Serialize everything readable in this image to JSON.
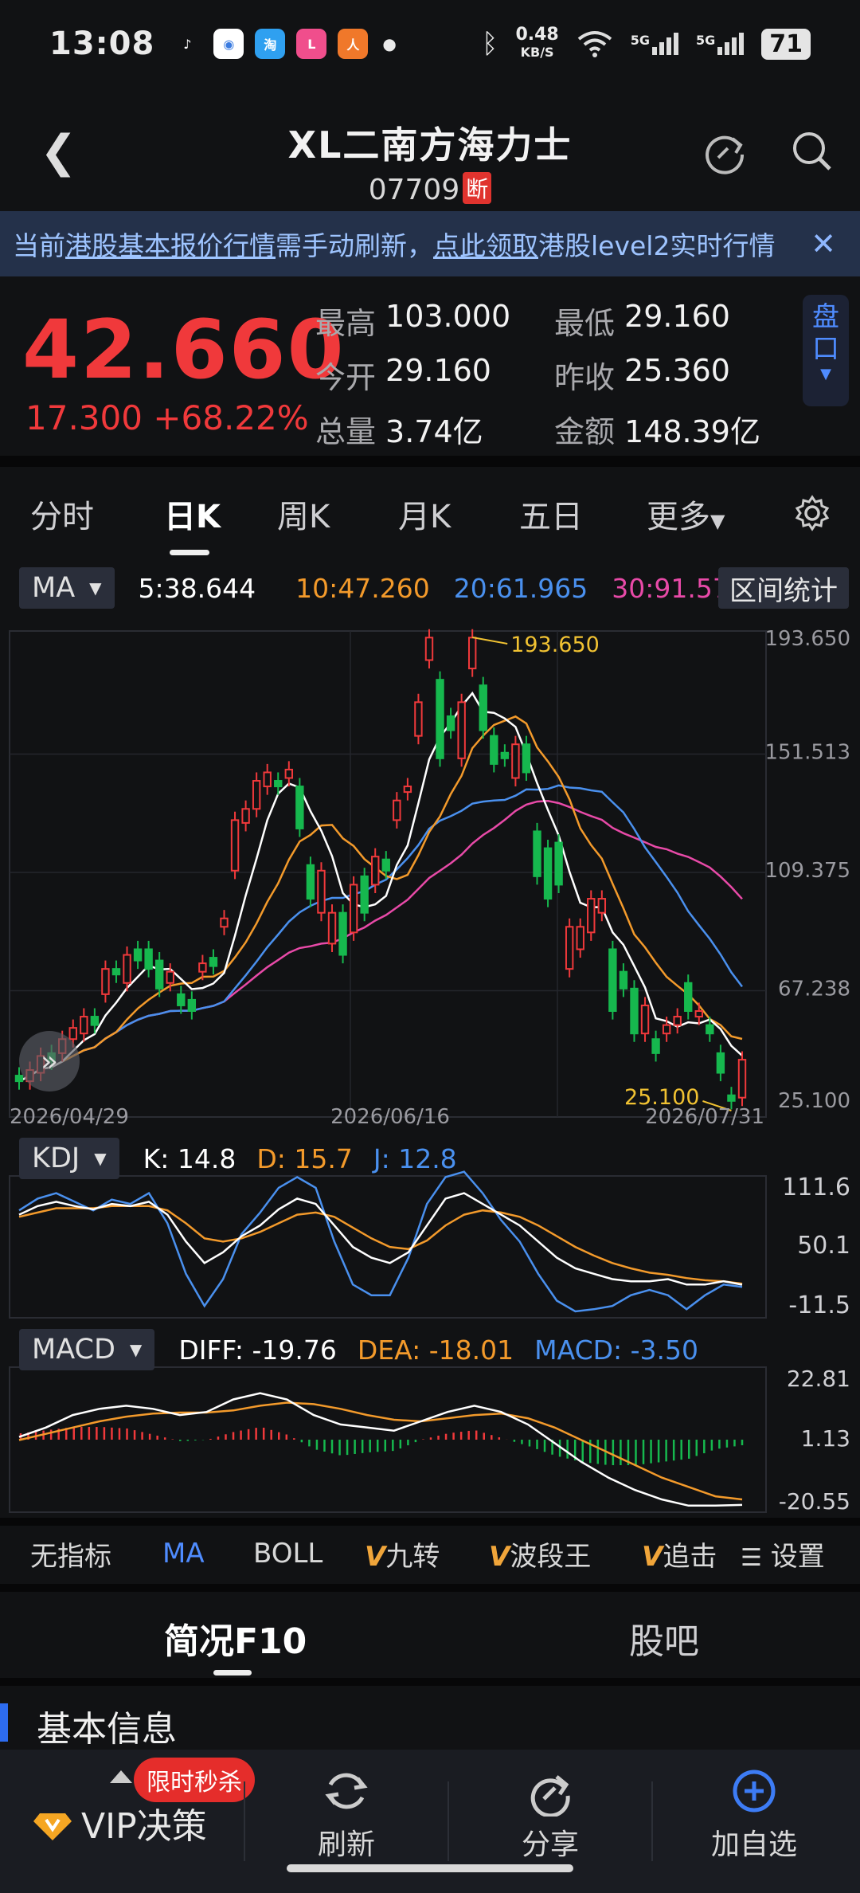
{
  "status_bar": {
    "time": "13:08",
    "net_speed": "0.48",
    "net_unit": "KB/S",
    "signal_1": "5G",
    "signal_2": "5G",
    "battery": "71",
    "apps": [
      {
        "name": "tiktok-icon",
        "color": "#111214",
        "glyph": "♪"
      },
      {
        "name": "app-icon-1",
        "color": "#ffffff",
        "glyph": "◉"
      },
      {
        "name": "app-icon-2",
        "color": "#2fa0f0",
        "glyph": "淘"
      },
      {
        "name": "app-icon-3",
        "color": "#f04e8c",
        "glyph": "L"
      },
      {
        "name": "app-icon-4",
        "color": "#f0782a",
        "glyph": "人"
      }
    ]
  },
  "header": {
    "title": "XL二南方海力士",
    "code": "07709",
    "halt_badge": "断"
  },
  "banner": {
    "text_1": "当前",
    "link_1": "港股基本报价行情",
    "text_2": "需手动刷新，",
    "link_2": "点此领取",
    "text_3": "港股level2实时行情",
    "close": "✕"
  },
  "quote": {
    "price": "42.660",
    "change_abs": "17.300",
    "change_pct": "+68.22%",
    "stats": [
      [
        {
          "label": "最高",
          "value": "103.000"
        },
        {
          "label": "最低",
          "value": "29.160"
        }
      ],
      [
        {
          "label": "今开",
          "value": "29.160"
        },
        {
          "label": "昨收",
          "value": "25.360"
        }
      ],
      [
        {
          "label": "总量",
          "value": "3.74亿"
        },
        {
          "label": "金额",
          "value": "148.39亿"
        }
      ]
    ],
    "pankou": [
      "盘",
      "口"
    ]
  },
  "tabs": {
    "items": [
      "分时",
      "日K",
      "周K",
      "月K",
      "五日",
      "更多"
    ],
    "active": "日K"
  },
  "ma_bar": {
    "button": "MA",
    "ma5": "5:38.644",
    "ma10": "10:47.260",
    "ma20": "20:61.965",
    "ma30": "30:91.578",
    "range_stats": "区间统计"
  },
  "kdj_bar": {
    "button": "KDJ",
    "k": "K: 14.8",
    "d": "D: 15.7",
    "j": "J: 12.8"
  },
  "macd_bar": {
    "button": "MACD",
    "diff": "DIFF: -19.76",
    "dea": "DEA: -18.01",
    "macd": "MACD: -3.50"
  },
  "indicator_bar": {
    "items": [
      "无指标",
      "MA",
      "BOLL",
      "九转",
      "波段王",
      "追击",
      "设置"
    ],
    "active": "MA",
    "v_prefix": "V"
  },
  "section_tabs": {
    "items": [
      "简况F10",
      "股吧"
    ],
    "active": "简况F10"
  },
  "basic_info": {
    "title": "基本信息"
  },
  "bottom_nav": {
    "vip_label": "VIP决策",
    "promo": "限时秒杀",
    "items": [
      "刷新",
      "分享",
      "加自选"
    ]
  },
  "colors": {
    "up": "#f0393b",
    "down": "#16b84e",
    "ma5": "#ffffff",
    "ma10": "#f39a2b",
    "ma20": "#4a90ee",
    "ma30": "#e84aa8",
    "accent": "#4f8cff"
  },
  "chart_data": [
    {
      "type": "candlestick",
      "title": "",
      "x_tick_labels": [
        "2026/04/29",
        "2026/06/16",
        "2026/07/31"
      ],
      "y_tick_labels": [
        "193.650",
        "151.513",
        "109.375",
        "67.238",
        "25.100"
      ],
      "ylim": [
        25.1,
        193.65
      ],
      "annotations": [
        {
          "text": "193.650",
          "kind": "max"
        },
        {
          "text": "25.100",
          "kind": "min"
        }
      ],
      "candles": [
        {
          "o": 37,
          "c": 35
        },
        {
          "o": 35,
          "c": 39
        },
        {
          "o": 38,
          "c": 44
        },
        {
          "o": 45,
          "c": 42
        },
        {
          "o": 45,
          "c": 50
        },
        {
          "o": 50,
          "c": 54
        },
        {
          "o": 52,
          "c": 58
        },
        {
          "o": 58,
          "c": 55
        },
        {
          "o": 66,
          "c": 75
        },
        {
          "o": 75,
          "c": 73
        },
        {
          "o": 70,
          "c": 80
        },
        {
          "o": 82,
          "c": 78
        },
        {
          "o": 82,
          "c": 75
        },
        {
          "o": 78,
          "c": 68
        },
        {
          "o": 70,
          "c": 74
        },
        {
          "o": 66,
          "c": 62
        },
        {
          "o": 64,
          "c": 60
        },
        {
          "o": 74,
          "c": 77
        },
        {
          "o": 79,
          "c": 76
        },
        {
          "o": 90,
          "c": 93
        },
        {
          "o": 110,
          "c": 128
        },
        {
          "o": 127,
          "c": 132
        },
        {
          "o": 132,
          "c": 142
        },
        {
          "o": 140,
          "c": 145
        },
        {
          "o": 142,
          "c": 140
        },
        {
          "o": 143,
          "c": 146
        },
        {
          "o": 140,
          "c": 125
        },
        {
          "o": 112,
          "c": 100
        },
        {
          "o": 95,
          "c": 110
        },
        {
          "o": 84,
          "c": 95
        },
        {
          "o": 95,
          "c": 80
        },
        {
          "o": 88,
          "c": 105
        },
        {
          "o": 108,
          "c": 95
        },
        {
          "o": 105,
          "c": 115
        },
        {
          "o": 114,
          "c": 110
        },
        {
          "o": 128,
          "c": 135
        },
        {
          "o": 138,
          "c": 140
        },
        {
          "o": 158,
          "c": 170
        },
        {
          "o": 185,
          "c": 193
        },
        {
          "o": 178,
          "c": 150
        },
        {
          "o": 165,
          "c": 160
        },
        {
          "o": 150,
          "c": 170
        },
        {
          "o": 182,
          "c": 193
        },
        {
          "o": 176,
          "c": 160
        },
        {
          "o": 158,
          "c": 148
        },
        {
          "o": 152,
          "c": 150
        },
        {
          "o": 143,
          "c": 155
        },
        {
          "o": 155,
          "c": 145
        },
        {
          "o": 124,
          "c": 108
        },
        {
          "o": 118,
          "c": 100
        },
        {
          "o": 120,
          "c": 105
        },
        {
          "o": 75,
          "c": 90
        },
        {
          "o": 82,
          "c": 90
        },
        {
          "o": 88,
          "c": 100
        },
        {
          "o": 95,
          "c": 100
        },
        {
          "o": 82,
          "c": 60
        },
        {
          "o": 74,
          "c": 68
        },
        {
          "o": 68,
          "c": 52
        },
        {
          "o": 52,
          "c": 62
        },
        {
          "o": 50,
          "c": 45
        },
        {
          "o": 52,
          "c": 55
        },
        {
          "o": 55,
          "c": 58
        },
        {
          "o": 70,
          "c": 60
        },
        {
          "o": 58,
          "c": 60
        },
        {
          "o": 55,
          "c": 52
        },
        {
          "o": 45,
          "c": 38
        },
        {
          "o": 30,
          "c": 28
        },
        {
          "o": 29.16,
          "c": 42.66
        }
      ]
    },
    {
      "type": "line",
      "title": "KDJ",
      "y_tick_labels": [
        "111.6",
        "50.1",
        "-11.5"
      ],
      "ylim": [
        -11.5,
        111.6
      ],
      "series": [
        {
          "name": "K",
          "values": [
            80,
            88,
            92,
            88,
            85,
            90,
            88,
            92,
            80,
            55,
            35,
            45,
            60,
            70,
            85,
            95,
            90,
            70,
            50,
            40,
            35,
            45,
            70,
            95,
            100,
            90,
            80,
            70,
            55,
            40,
            30,
            25,
            20,
            18,
            18,
            20,
            15,
            15,
            18,
            14.8
          ]
        },
        {
          "name": "D",
          "values": [
            78,
            82,
            86,
            86,
            86,
            88,
            88,
            88,
            84,
            72,
            58,
            55,
            58,
            64,
            72,
            80,
            82,
            78,
            68,
            58,
            50,
            48,
            56,
            70,
            80,
            84,
            82,
            78,
            70,
            60,
            50,
            42,
            35,
            30,
            26,
            24,
            21,
            19,
            18,
            15.7
          ]
        },
        {
          "name": "J",
          "values": [
            84,
            95,
            100,
            92,
            84,
            94,
            90,
            100,
            72,
            25,
            -5,
            20,
            62,
            82,
            105,
            115,
            105,
            55,
            15,
            5,
            5,
            40,
            90,
            115,
            120,
            100,
            75,
            55,
            25,
            0,
            -10,
            -8,
            -5,
            5,
            10,
            5,
            -8,
            5,
            15,
            12.8
          ]
        }
      ]
    },
    {
      "type": "line",
      "title": "MACD",
      "y_tick_labels": [
        "22.81",
        "1.13",
        "-20.55"
      ],
      "ylim": [
        -20.55,
        22.81
      ],
      "series": [
        {
          "name": "DIFF",
          "values": [
            2,
            5,
            9,
            11,
            12,
            11,
            9,
            10,
            14,
            16,
            14,
            9,
            6,
            5,
            4,
            7,
            10,
            12,
            10,
            6,
            0,
            -6,
            -11,
            -15,
            -18,
            -20,
            -20,
            -19.76
          ]
        },
        {
          "name": "DEA",
          "values": [
            1,
            3,
            5,
            7,
            8.5,
            9.5,
            9.8,
            9.8,
            10.5,
            12,
            13,
            12.5,
            11,
            9,
            7.5,
            7,
            8,
            9,
            9.5,
            8,
            5,
            1,
            -3,
            -7,
            -11,
            -14,
            -17,
            -18.01
          ]
        },
        {
          "name": "MACD",
          "values": [
            4,
            6,
            8,
            8,
            7,
            3,
            -1,
            0,
            5,
            8,
            3,
            -6,
            -10,
            -8,
            -7,
            0,
            4,
            6,
            1,
            -4,
            -10,
            -14,
            -16,
            -16,
            -14,
            -12,
            -6,
            -3.5
          ]
        }
      ]
    }
  ]
}
